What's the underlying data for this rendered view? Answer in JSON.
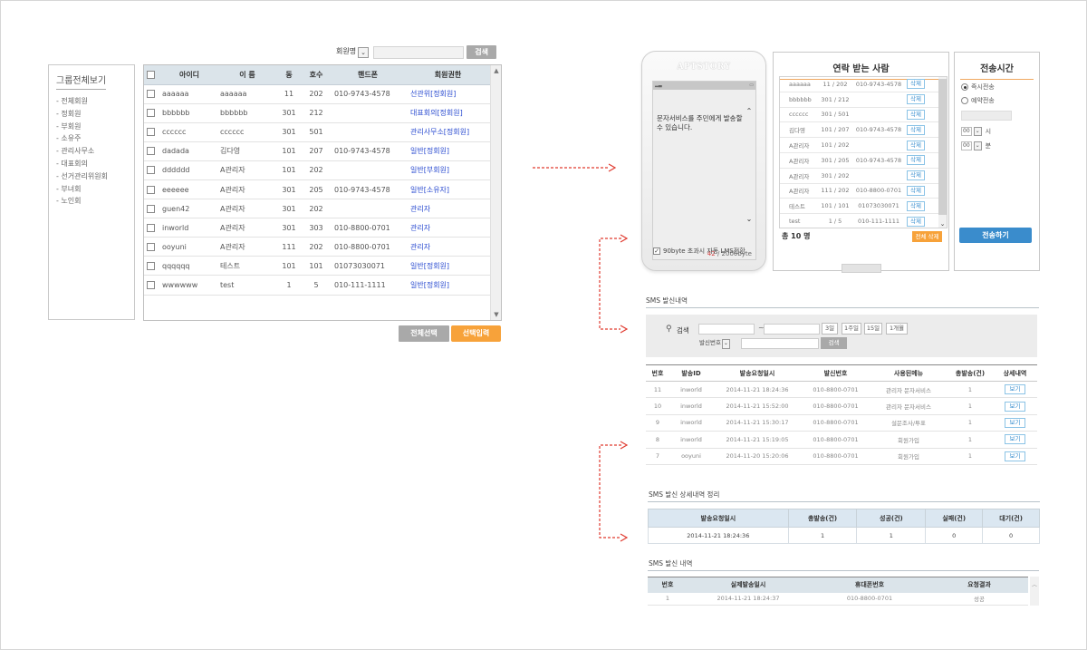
{
  "member_search": {
    "select_label": "회원명",
    "search_button": "검색"
  },
  "group_panel": {
    "title": "그룹전체보기",
    "items": [
      "- 전체회원",
      "- 정회원",
      "- 부회원",
      "- 소유주",
      "- 관리사무소",
      "- 대표회의",
      "- 선거관리위원회",
      "- 부녀회",
      "- 노인회"
    ]
  },
  "member_table": {
    "headers": [
      "아이디",
      "이 름",
      "동",
      "호수",
      "핸드폰",
      "회원권한"
    ],
    "rows": [
      {
        "id": "aaaaaa",
        "name": "aaaaaa",
        "dong": "11",
        "ho": "202",
        "phone": "010-9743-4578",
        "role": "선관위[정회원]"
      },
      {
        "id": "bbbbbb",
        "name": "bbbbbb",
        "dong": "301",
        "ho": "212",
        "phone": "",
        "role": "대표회의[정회원]"
      },
      {
        "id": "cccccc",
        "name": "cccccc",
        "dong": "301",
        "ho": "501",
        "phone": "",
        "role": "관리사무소[정회원]"
      },
      {
        "id": "dadada",
        "name": "김다영",
        "dong": "101",
        "ho": "207",
        "phone": "010-9743-4578",
        "role": "일반[정회원]"
      },
      {
        "id": "dddddd",
        "name": "A관리자",
        "dong": "101",
        "ho": "202",
        "phone": "",
        "role": "일반[부회원]"
      },
      {
        "id": "eeeeee",
        "name": "A관리자",
        "dong": "301",
        "ho": "205",
        "phone": "010-9743-4578",
        "role": "일반[소유자]"
      },
      {
        "id": "guen42",
        "name": "A관리자",
        "dong": "301",
        "ho": "202",
        "phone": "",
        "role": "관리자"
      },
      {
        "id": "inworld",
        "name": "A관리자",
        "dong": "301",
        "ho": "303",
        "phone": "010-8800-0701",
        "role": "관리자"
      },
      {
        "id": "ooyuni",
        "name": "A관리자",
        "dong": "111",
        "ho": "202",
        "phone": "010-8800-0701",
        "role": "관리자"
      },
      {
        "id": "qqqqqq",
        "name": "테스트",
        "dong": "101",
        "ho": "101",
        "phone": "01073030071",
        "role": "일반[정회원]"
      },
      {
        "id": "wwwwww",
        "name": "test",
        "dong": "1",
        "ho": "5",
        "phone": "010-111-1111",
        "role": "일반[정회원]"
      }
    ],
    "select_all_button": "전체선택",
    "select_input_button": "선택입력"
  },
  "phone": {
    "brand": "APTSTORY",
    "message": "문자서비스를 주민에게 발송할 수 있습니다.",
    "count_current": "42",
    "count_max": "/ 2000byte",
    "lms_label": "90byte 초과시 자동 LMS전환"
  },
  "recipients": {
    "title": "연락 받는 사람",
    "delete_label": "삭제",
    "rows": [
      {
        "name": "aaaaaa",
        "unit": "11 / 202",
        "phone": "010-9743-4578"
      },
      {
        "name": "bbbbbb",
        "unit": "301 / 212",
        "phone": ""
      },
      {
        "name": "cccccc",
        "unit": "301 / 501",
        "phone": ""
      },
      {
        "name": "김다영",
        "unit": "101 / 207",
        "phone": "010-9743-4578"
      },
      {
        "name": "A관리자",
        "unit": "101 / 202",
        "phone": ""
      },
      {
        "name": "A관리자",
        "unit": "301 / 205",
        "phone": "010-9743-4578"
      },
      {
        "name": "A관리자",
        "unit": "301 / 202",
        "phone": ""
      },
      {
        "name": "A관리자",
        "unit": "111 / 202",
        "phone": "010-8800-0701"
      },
      {
        "name": "테스트",
        "unit": "101 / 101",
        "phone": "01073030071"
      },
      {
        "name": "test",
        "unit": "1 / 5",
        "phone": "010-111-1111"
      }
    ],
    "total": "총 10 명",
    "delete_all": "전체 삭제"
  },
  "send_time": {
    "title": "전송시간",
    "immediate": "즉시전송",
    "reserve": "예약전송",
    "hour_value": "00",
    "hour_unit": "시",
    "minute_value": "00",
    "minute_unit": "분",
    "send_button": "전송하기"
  },
  "sms_history": {
    "title": "SMS 발신내역",
    "search_label": "검색",
    "tilde": "~",
    "periods": [
      "3일",
      "1주일",
      "15일",
      "1개월"
    ],
    "sender_select": "발신번호",
    "search_button": "검색",
    "headers": [
      "번호",
      "발송ID",
      "발송요청일시",
      "발신번호",
      "사용된메뉴",
      "총발송(건)",
      "상세내역"
    ],
    "rows": [
      {
        "no": "11",
        "id": "inworld",
        "date": "2014-11-21 18:24:36",
        "sender": "010-8800-0701",
        "menu": "관리자 문자서비스",
        "count": "1",
        "detail": "보기"
      },
      {
        "no": "10",
        "id": "inworld",
        "date": "2014-11-21 15:52:00",
        "sender": "010-8800-0701",
        "menu": "관리자 문자서비스",
        "count": "1",
        "detail": "보기"
      },
      {
        "no": "9",
        "id": "inworld",
        "date": "2014-11-21 15:30:17",
        "sender": "010-8800-0701",
        "menu": "설문조사/투표",
        "count": "1",
        "detail": "보기"
      },
      {
        "no": "8",
        "id": "inworld",
        "date": "2014-11-21 15:19:05",
        "sender": "010-8800-0701",
        "menu": "회원가입",
        "count": "1",
        "detail": "보기"
      },
      {
        "no": "7",
        "id": "ooyuni",
        "date": "2014-11-20 15:20:06",
        "sender": "010-8800-0701",
        "menu": "회원가입",
        "count": "1",
        "detail": "보기"
      }
    ]
  },
  "sms_detail": {
    "title": "SMS 발신 상세내역 정리",
    "headers": [
      "발송요청일시",
      "총발송(건)",
      "성공(건)",
      "실패(건)",
      "대기(건)"
    ],
    "row": [
      "2014-11-21 18:24:36",
      "1",
      "1",
      "0",
      "0"
    ]
  },
  "sms_send_list": {
    "title": "SMS 발신 내역",
    "headers": [
      "번호",
      "실제발송일시",
      "휴대폰번호",
      "요청결과"
    ],
    "row": [
      "1",
      "2014-11-21 18:24:37",
      "010-8800-0701",
      "성공"
    ]
  },
  "colors": {
    "accent_orange": "#f7a23a",
    "link_blue": "#2a4bd0",
    "send_blue": "#3a8ccc",
    "arrow_red": "#e03a2f"
  }
}
